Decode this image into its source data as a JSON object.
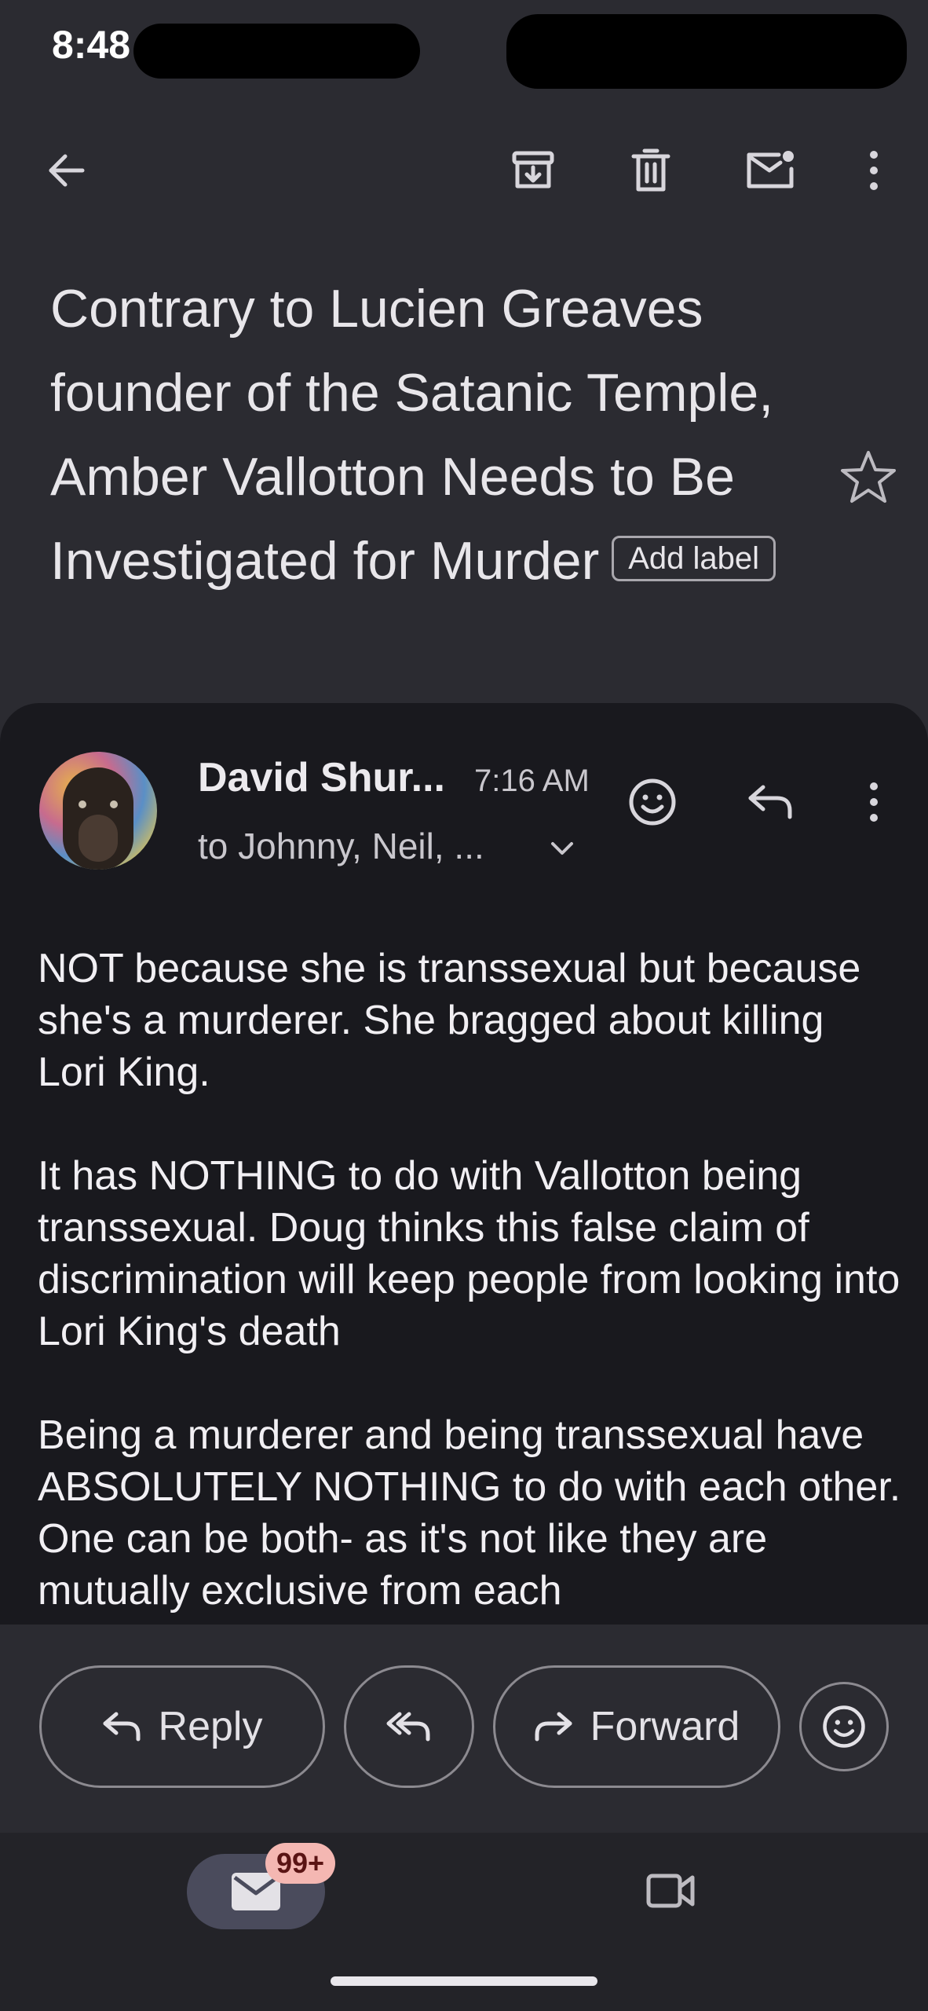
{
  "status_bar": {
    "time": "8:48"
  },
  "toolbar": {
    "back_icon": "arrow-left",
    "archive_icon": "archive-box",
    "delete_icon": "trash",
    "mark_unread_icon": "envelope-dot",
    "more_icon": "vertical-dots"
  },
  "email": {
    "subject": "Contrary to Lucien Greaves founder of the Satanic Temple, Amber Vallotton Needs to Be Investigated for Murder",
    "add_label": "Add label",
    "sender": "David Shur...",
    "time": "7:16 AM",
    "recipients": "to Johnny, Neil, ...",
    "body": [
      "NOT because she is transsexual but because she's a murderer. She bragged about killing Lori King.",
      "It has NOTHING to do with Vallotton being transsexual. Doug thinks this false claim of discrimination will keep people from looking into Lori King's death",
      "Being a murderer and being transsexual have ABSOLUTELY NOTHING to do with each other. One can be both- as it's not like they are mutually exclusive from each"
    ]
  },
  "actions": {
    "reply": "Reply",
    "forward": "Forward"
  },
  "nav": {
    "mail_badge": "99+"
  },
  "colors": {
    "background": "#2b2b31",
    "card": "#19191e",
    "badge": "#f4b7b2",
    "nav_active": "#4a4b5c"
  }
}
